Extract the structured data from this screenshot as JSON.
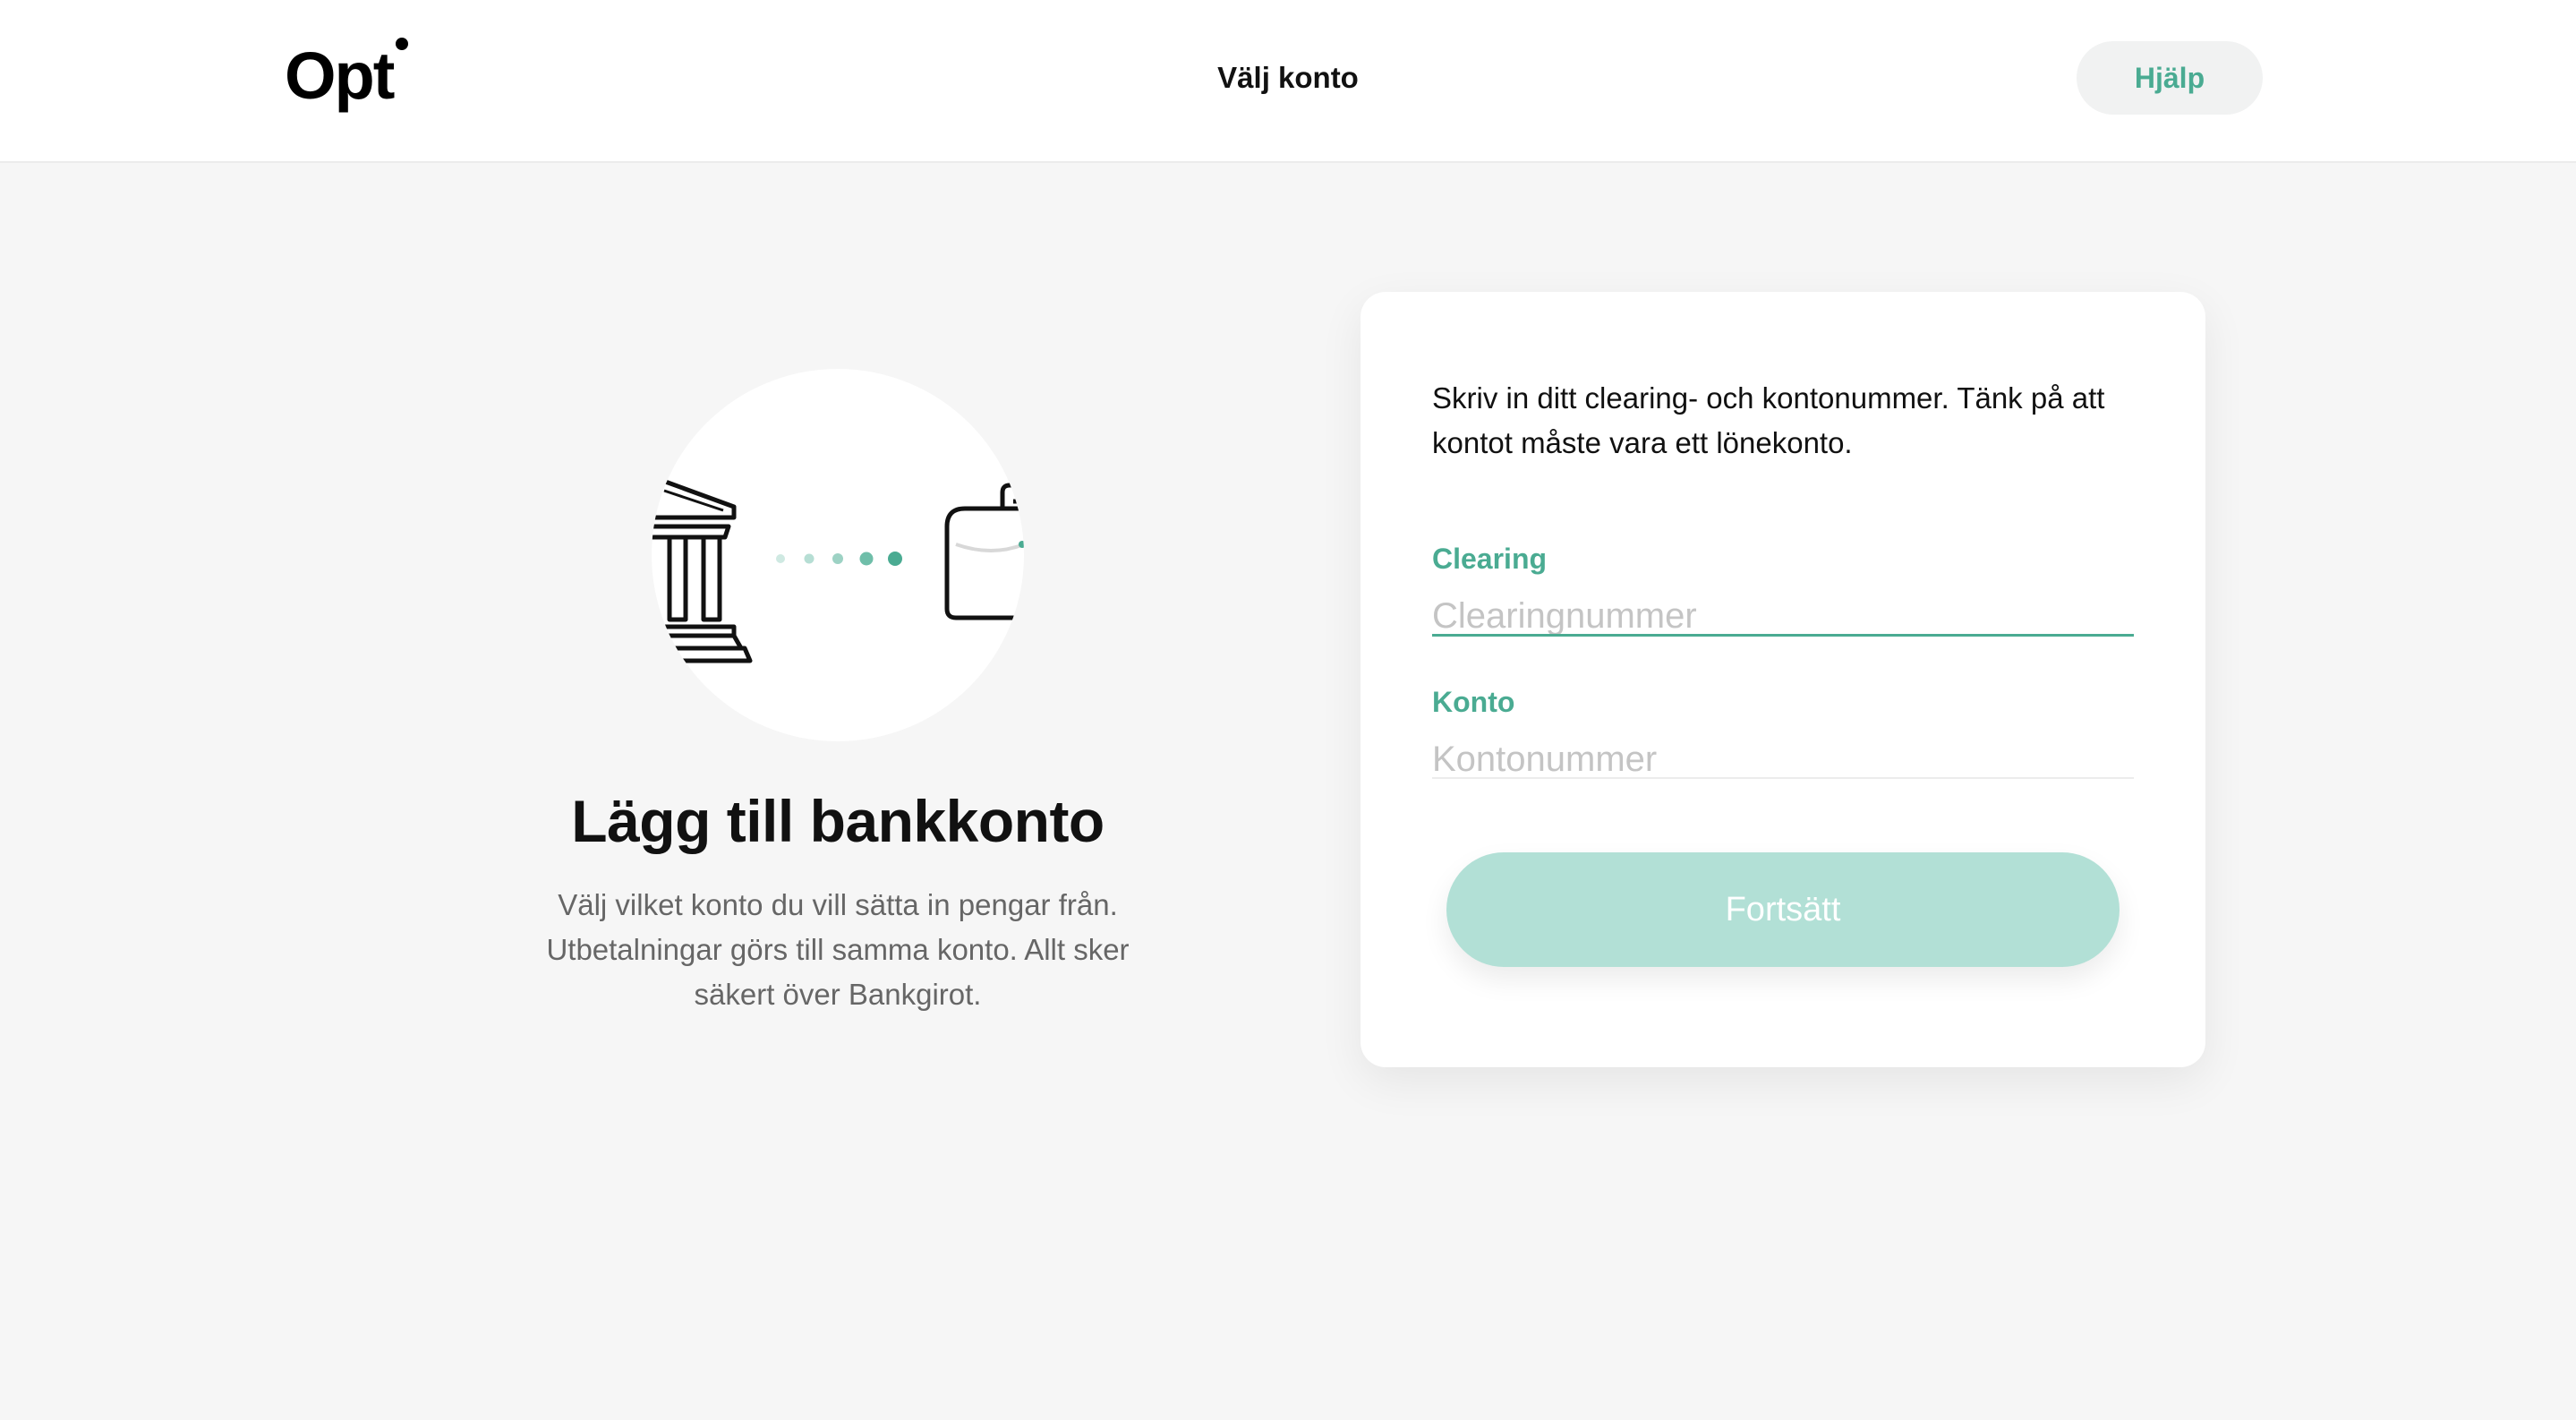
{
  "header": {
    "logo_text": "Opt",
    "title": "Välj konto",
    "help_label": "Hjälp"
  },
  "hero": {
    "illustration_icons": [
      "bank-icon",
      "progress-dots",
      "wallet-icon"
    ],
    "title": "Lägg till bankkonto",
    "description": "Välj vilket konto du vill sätta in pengar från. Utbetalningar görs till samma konto. Allt sker säkert över Bankgirot."
  },
  "form": {
    "intro": "Skriv in ditt clearing- och kontonummer. Tänk på att kontot måste vara ett lönekonto.",
    "clearing": {
      "label": "Clearing",
      "placeholder": "Clearingnummer",
      "value": ""
    },
    "account": {
      "label": "Konto",
      "placeholder": "Kontonummer",
      "value": ""
    },
    "continue_label": "Fortsätt"
  },
  "colors": {
    "accent": "#4aab92",
    "button_disabled": "#b2e0d6",
    "background": "#f6f6f6",
    "help_button_bg": "#f1f2f2"
  }
}
